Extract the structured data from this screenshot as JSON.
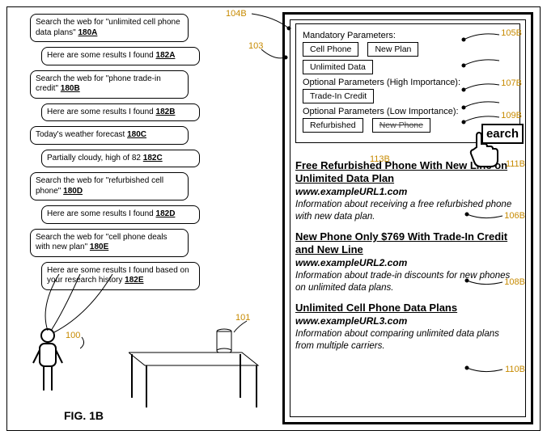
{
  "figure_label": "FIG. 1B",
  "callouts": {
    "c100": "100",
    "c101": "101",
    "c103": "103",
    "c104B": "104B",
    "c105B": "105B",
    "c106B": "106B",
    "c107B": "107B",
    "c108B": "108B",
    "c109B": "109B",
    "c110B": "110B",
    "c111B": "111B",
    "c113B": "113B"
  },
  "bubbles": [
    {
      "role": "user",
      "text": "Search the web for \"unlimited cell phone data plans\"",
      "ref": "180A"
    },
    {
      "role": "sys",
      "text": "Here are some results I found",
      "ref": "182A"
    },
    {
      "role": "user",
      "text": "Search the web for \"phone trade-in credit\"",
      "ref": "180B"
    },
    {
      "role": "sys",
      "text": "Here are some results I found",
      "ref": "182B"
    },
    {
      "role": "user",
      "text": "Today's weather forecast",
      "ref": "180C"
    },
    {
      "role": "sys",
      "text": "Partially cloudy, high of 82",
      "ref": "182C"
    },
    {
      "role": "user",
      "text": "Search the web for \"refurbished cell phone\"",
      "ref": "180D"
    },
    {
      "role": "sys",
      "text": "Here are some results I found",
      "ref": "182D"
    },
    {
      "role": "user",
      "text": "Search the web for \"cell phone deals with new plan\"",
      "ref": "180E"
    },
    {
      "role": "sys",
      "text": "Here are some results I found based on your research history",
      "ref": "182E"
    }
  ],
  "panel": {
    "mandatory_label": "Mandatory Parameters:",
    "mandatory": [
      "Cell Phone",
      "New Plan",
      "Unlimited Data"
    ],
    "high_label": "Optional Parameters (High Importance):",
    "high": [
      "Trade-In Credit"
    ],
    "low_label": "Optional Parameters (Low Importance):",
    "low": [
      "Refurbished"
    ],
    "low_struck": "New Phone",
    "search_label": "earch"
  },
  "results": [
    {
      "title": "Free Refurbished Phone With New Line on Unlimited Data Plan",
      "url": "www.exampleURL1.com",
      "desc": "Information about receiving a free refurbished phone with new data plan."
    },
    {
      "title": "New Phone Only $769 With Trade-In Credit and New Line",
      "url": "www.exampleURL2.com",
      "desc": "Information about trade-in discounts for new phones on unlimited data plans."
    },
    {
      "title": "Unlimited Cell Phone Data Plans",
      "url": "www.exampleURL3.com",
      "desc": "Information about comparing unlimited data plans from multiple carriers."
    }
  ]
}
